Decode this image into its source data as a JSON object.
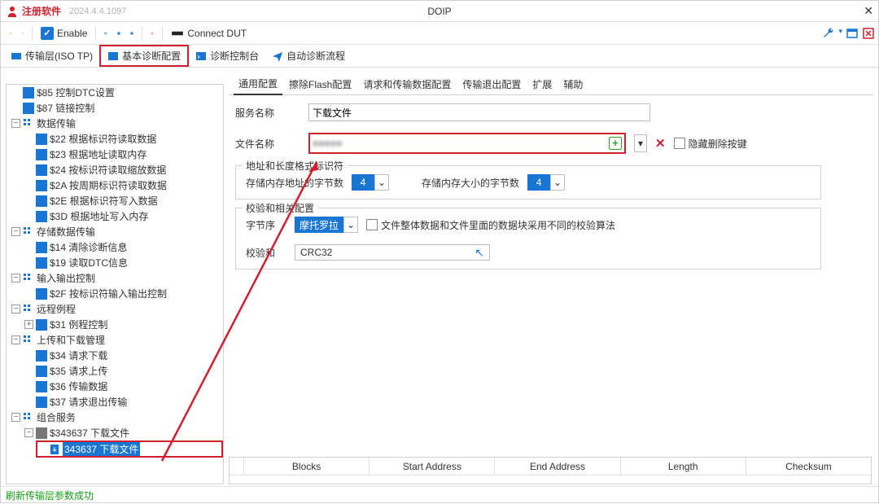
{
  "title": {
    "app": "注册软件",
    "version": "2024.4.4.1097",
    "center": "DOIP"
  },
  "toolbar": {
    "enable": "Enable",
    "connect": "Connect DUT"
  },
  "tabs2": {
    "t1": "传输层(ISO TP)",
    "t2": "基本诊断配置",
    "t3": "诊断控制台",
    "t4": "自动诊断流程"
  },
  "tree": {
    "n1": "$85 控制DTC设置",
    "n2": "$87 链接控制",
    "g1": "数据传输",
    "n3": "$22 根据标识符读取数据",
    "n4": "$23 根据地址读取内存",
    "n5": "$24 按标识符读取缩放数据",
    "n6": "$2A 按周期标识符读取数据",
    "n7": "$2E 根据标识符写入数据",
    "n8": "$3D 根据地址写入内存",
    "g2": "存储数据传输",
    "n9": "$14 清除诊断信息",
    "n10": "$19 读取DTC信息",
    "g3": "输入输出控制",
    "n11": "$2F 按标识符输入输出控制",
    "g4": "远程例程",
    "n12": "$31 例程控制",
    "g5": "上传和下载管理",
    "n13": "$34 请求下载",
    "n14": "$35 请求上传",
    "n15": "$36 传输数据",
    "n16": "$37 请求退出传输",
    "g6": "组合服务",
    "n17": "$343637 下载文件",
    "n18": "343637 下载文件"
  },
  "panelTabs": {
    "p1": "通用配置",
    "p2": "擦除Flash配置",
    "p3": "请求和传输数据配置",
    "p4": "传输退出配置",
    "p5": "扩展",
    "p6": "辅助"
  },
  "form": {
    "svcNameLabel": "服务名称",
    "svcNameVal": "下载文件",
    "fileNameLabel": "文件名称",
    "fileNameVal": "■■■■■",
    "hideDel": "隐藏删除按键",
    "fs1": "地址和长度格式标识符",
    "f1a": "存储内存地址的字节数",
    "f1aVal": "4",
    "f1b": "存储内存大小的字节数",
    "f1bVal": "4",
    "fs2": "校验和相关配置",
    "f2a": "字节序",
    "f2aVal": "摩托罗拉",
    "f2chk": "文件整体数据和文件里面的数据块采用不同的校验算法",
    "f2b": "校验和",
    "f2bVal": "CRC32"
  },
  "gridCols": {
    "c0": "",
    "c1": "Blocks",
    "c2": "Start Address",
    "c3": "End Address",
    "c4": "Length",
    "c5": "Checksum"
  },
  "status": "刷新传输层参数成功"
}
